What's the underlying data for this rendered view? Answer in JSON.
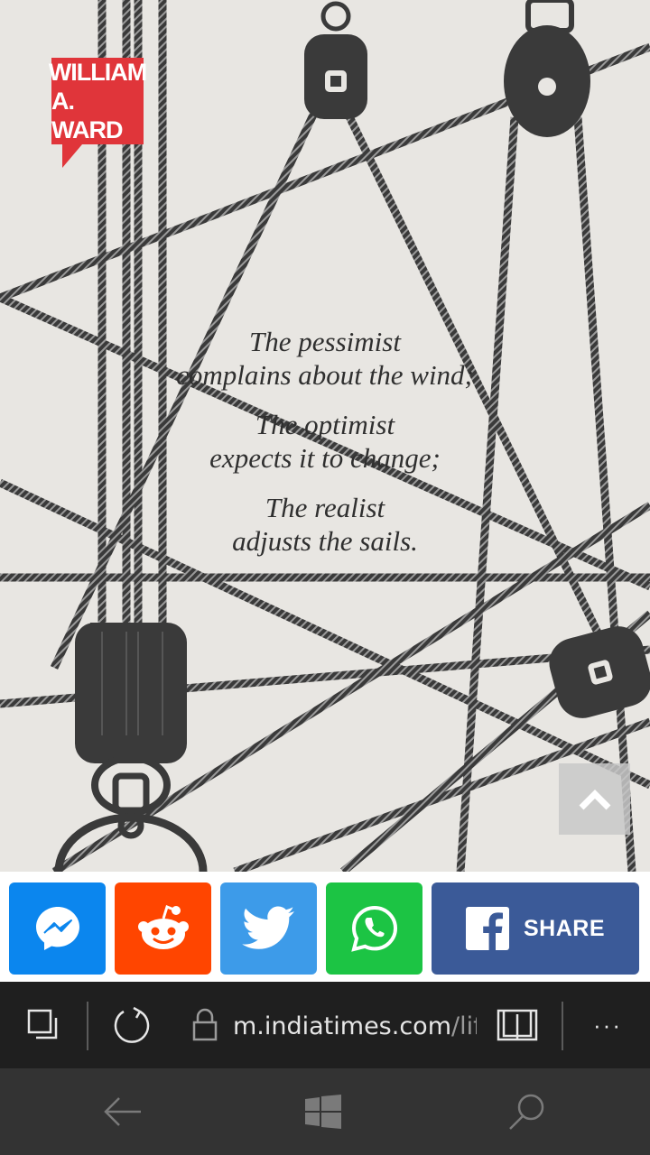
{
  "poster": {
    "author_lines": [
      "WILLIAM",
      "A. WARD"
    ],
    "quote_lines": [
      [
        "The pessimist",
        "complains about the wind;"
      ],
      [
        "The optimist",
        "expects it to change;"
      ],
      [
        "The realist",
        "adjusts the sails."
      ]
    ],
    "scroll_top_icon": "chevron-up-icon"
  },
  "share": {
    "messenger_icon": "messenger-icon",
    "reddit_icon": "reddit-icon",
    "twitter_icon": "twitter-icon",
    "whatsapp_icon": "whatsapp-icon",
    "facebook_icon": "facebook-icon",
    "facebook_label": "SHARE"
  },
  "browser": {
    "url_host": "m.indiatimes.com",
    "url_path": "/lif",
    "tabs_icon": "tabs-icon",
    "refresh_icon": "refresh-icon",
    "lock_icon": "lock-icon",
    "reading_icon": "reading-view-icon",
    "more_label": "···"
  },
  "nav": {
    "back_icon": "back-arrow-icon",
    "home_icon": "windows-logo-icon",
    "search_icon": "search-icon"
  },
  "colors": {
    "messenger": "#0b86ee",
    "reddit": "#ff4500",
    "twitter": "#3d9be9",
    "whatsapp": "#1cc444",
    "facebook": "#3b5a98",
    "badge": "#e0353a"
  }
}
